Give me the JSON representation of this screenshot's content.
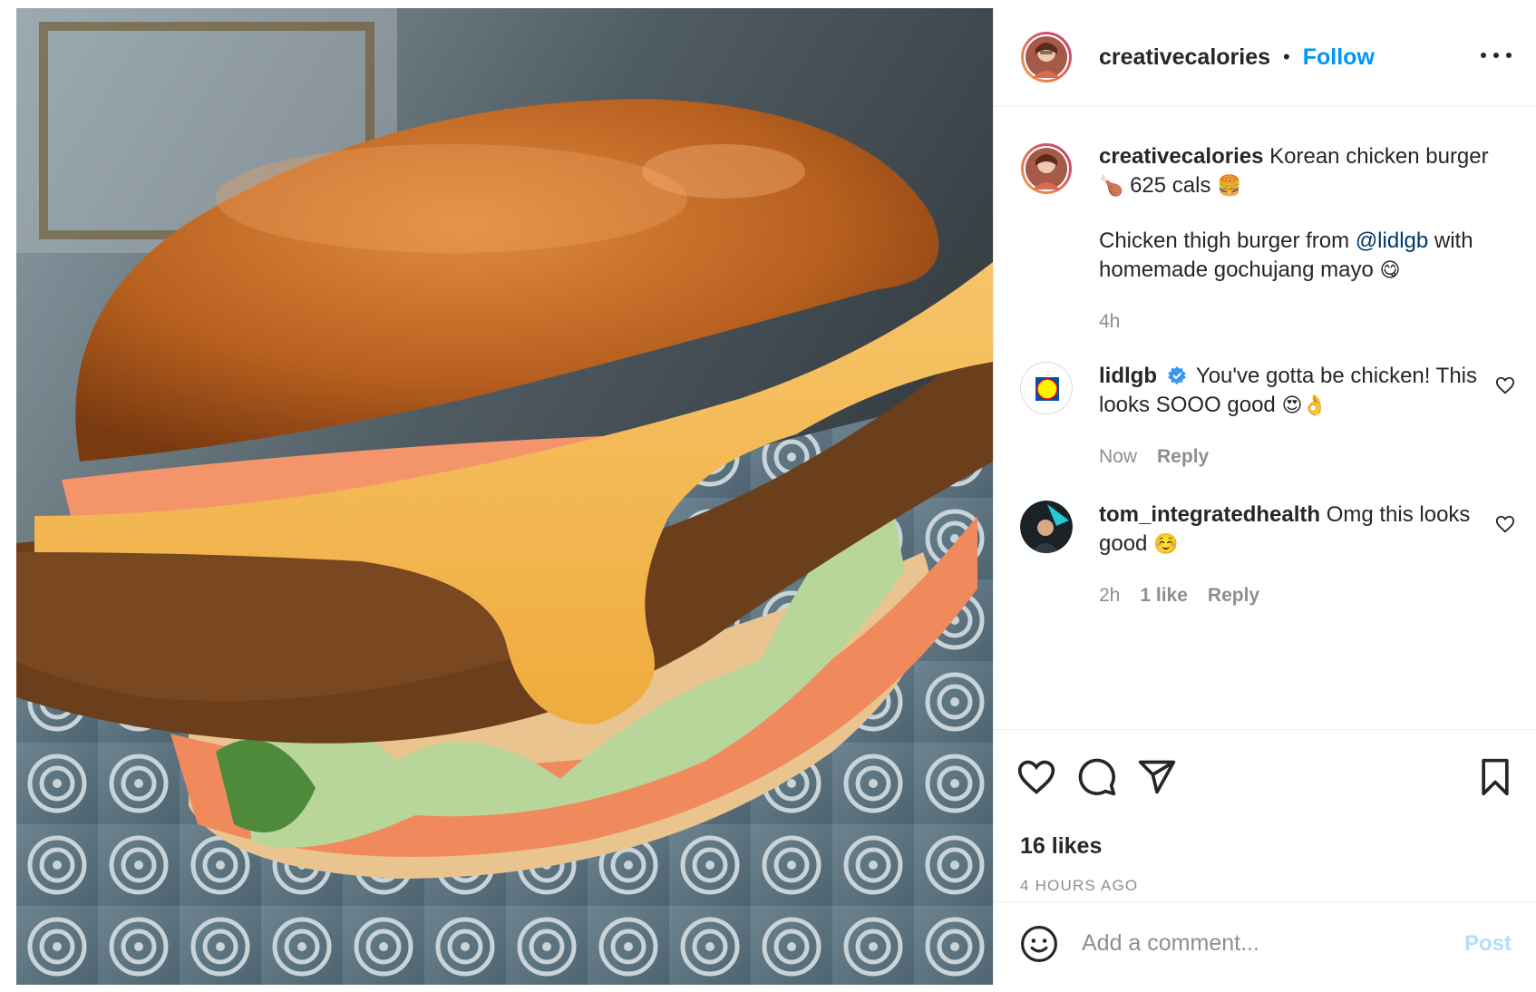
{
  "post": {
    "photo_alt": "Korean chicken burger with cheese, lettuce and gochujang mayo on a patterned plate"
  },
  "header": {
    "username": "creativecalories",
    "separator": "•",
    "follow_label": "Follow",
    "more_icon": "more-horizontal-icon"
  },
  "caption": {
    "username": "creativecalories",
    "line1_text": "Korean chicken burger",
    "emoji1": "🍗",
    "line1_tail": "625 cals",
    "emoji2": "🍔",
    "line2_text": "Chicken thigh burger from",
    "mention": "@lidlgb",
    "line2_tail": "with homemade gochujang mayo",
    "emoji3": "😋",
    "time": "4h"
  },
  "comments": [
    {
      "username": "lidlgb",
      "verified": true,
      "text": "You've gotta be chicken! This looks SOOO good",
      "emoji": "😍👌",
      "time": "Now",
      "likes": "",
      "reply_label": "Reply"
    },
    {
      "username": "tom_integratedhealth",
      "verified": false,
      "text": "Omg this looks good",
      "emoji": "☺️",
      "time": "2h",
      "likes": "1 like",
      "reply_label": "Reply"
    }
  ],
  "actions": {
    "like_icon": "heart-icon",
    "comment_icon": "comment-icon",
    "share_icon": "send-icon",
    "save_icon": "bookmark-icon",
    "likes_text": "16 likes",
    "posted_ago": "4 HOURS AGO"
  },
  "add_comment": {
    "placeholder": "Add a comment...",
    "post_label": "Post",
    "emoji_icon": "smiley-icon"
  },
  "colors": {
    "link_blue": "#0095f6",
    "mention_blue": "#00376b",
    "muted": "#8e8e8e",
    "post_disabled": "#b2dffc",
    "border": "#efefef"
  }
}
